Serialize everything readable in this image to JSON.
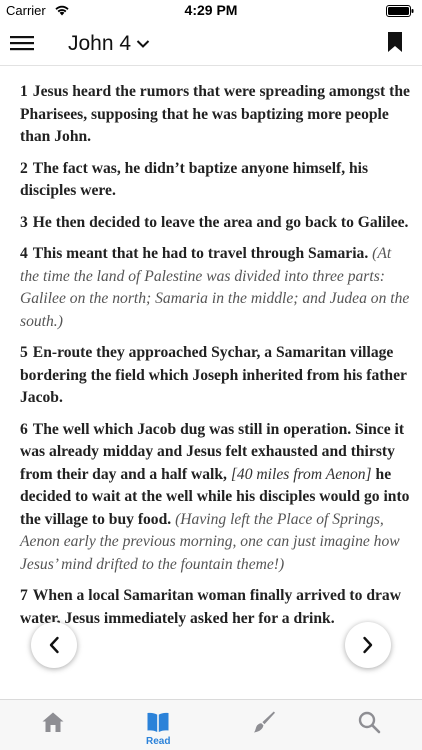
{
  "status_bar": {
    "carrier": "Carrier",
    "time": "4:29 PM"
  },
  "nav": {
    "chapter": "John 4"
  },
  "verses": [
    {
      "num": "1",
      "text": "Jesus heard the rumors that were spreading amongst the Pharisees, supposing that he was baptizing more people than John."
    },
    {
      "num": "2",
      "text": "The fact was, he didn’t baptize anyone himself, his disciples were."
    },
    {
      "num": "3",
      "text": "He then decided to leave the area and go back to Galilee."
    },
    {
      "num": "4",
      "text": "This meant that he had to travel through Samaria.",
      "note": "(At the time the land of Palestine was divided into three parts: Galilee on the north; Samaria in the middle; and Judea on the south.)"
    },
    {
      "num": "5",
      "text": "En-route they approached Sychar, a Samaritan village bordering the field which Joseph inherited from his father Jacob."
    },
    {
      "num": "6",
      "text_a": "The well which Jacob dug was still in operation. Since it was already midday and Jesus felt exhausted and thirsty from their day and a half walk,",
      "bracket": "[40 miles from Aenon]",
      "text_b": "he decided to wait at the well while his disciples would go into the village to buy food.",
      "note": "(Having left the Place of Springs, Aenon early the previous morning, one can just imagine how Jesus’ mind drifted to the fountain theme!)"
    },
    {
      "num": "7",
      "text": "When a local Samaritan woman finally arrived to draw water, Jesus immediately asked her for a drink."
    }
  ],
  "tabs": [
    {
      "icon": "home-icon",
      "label": ""
    },
    {
      "icon": "book-open-icon",
      "label": "Read"
    },
    {
      "icon": "paintbrush-icon",
      "label": ""
    },
    {
      "icon": "search-icon",
      "label": ""
    }
  ],
  "colors": {
    "accent": "#2b82d9",
    "inactive_icon": "#8e8e93",
    "text": "#222222",
    "note": "#555555"
  }
}
